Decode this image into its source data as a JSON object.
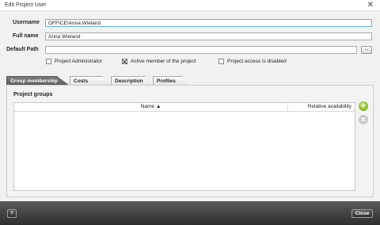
{
  "window": {
    "title": "Edit Project User",
    "close_icon": "close-icon"
  },
  "form": {
    "username_label": "Username",
    "username_value": "OFFICE\\Anna.Wieland",
    "fullname_label": "Full name",
    "fullname_value": "Anna Wieland",
    "defaultpath_label": "Default Path",
    "defaultpath_value": "",
    "browse_label": "..."
  },
  "checkboxes": {
    "project_admin": {
      "label": "Project Administrator",
      "checked": false
    },
    "active_member": {
      "label": "Active member of the project",
      "checked": true
    },
    "access_disabled": {
      "label": "Project access is disabled",
      "checked": false
    }
  },
  "tabs": [
    "Group membership",
    "Costs",
    "Description",
    "Profiles"
  ],
  "active_tab": "Group membership",
  "panel": {
    "title": "Project groups",
    "columns": {
      "name": "Name ▲",
      "availability": "Relative availability"
    },
    "rows": []
  },
  "footer": {
    "help_label": "?",
    "close_label": "Close"
  },
  "colors": {
    "accent_focus": "#6bb3d8",
    "add_button": "#7fb51f",
    "footer_bg": "#3a3a3a"
  }
}
